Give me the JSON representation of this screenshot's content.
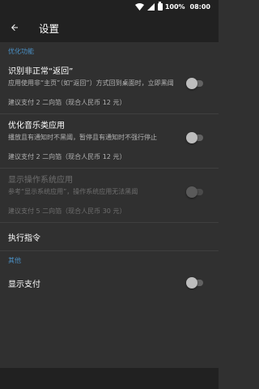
{
  "status": {
    "battery_percent": "100%",
    "time": "08:00"
  },
  "header": {
    "title": "设置"
  },
  "sections": {
    "optimize": {
      "header": "优化功能",
      "items": [
        {
          "title": "识别非正常“返回”",
          "summary": "应用使用非“主页”（如“返回”）方式回到桌面时，立即黑阈",
          "note": "建议支付 2 二向箔（现合人民币 12 元）",
          "enabled": true,
          "checked": false
        },
        {
          "title": "优化音乐类应用",
          "summary": "播放且有通知时不黑阈，暂停且有通知时不强行停止",
          "note": "建议支付 2 二向箔（现合人民币 12 元）",
          "enabled": true,
          "checked": false
        },
        {
          "title": "显示操作系统应用",
          "summary": "参考“显示系统应用”，操作系统应用无法黑阈",
          "note": "建议支付 5 二向箔（现合人民币 30 元）",
          "enabled": false,
          "checked": false
        }
      ],
      "action": "执行指令"
    },
    "misc": {
      "header": "其他",
      "item": {
        "title": "显示支付",
        "checked": false
      }
    }
  }
}
